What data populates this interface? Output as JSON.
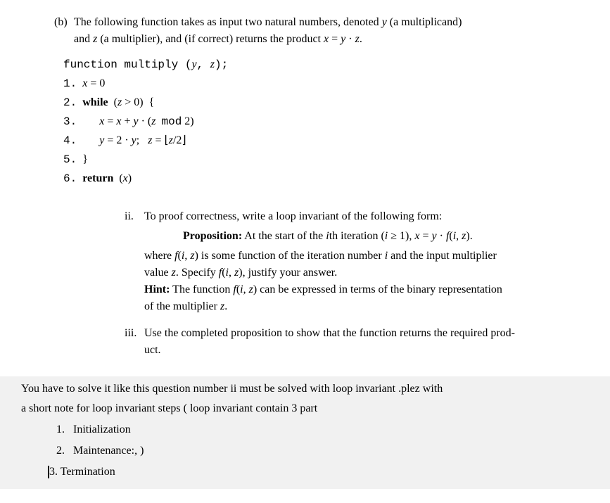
{
  "partLabel": "(b)",
  "intro": {
    "line1": "The following function takes as input two natural numbers, denoted y (a multiplicand)",
    "line2": "and z (a multiplier), and (if correct) returns the product x = y · z."
  },
  "code": {
    "header": "function multiply (y, z);",
    "line1_num": "1.",
    "line1_text": "x = 0",
    "line2_num": "2.",
    "line2_while": "while",
    "line2_cond": "(z > 0)  {",
    "line3_num": "3.",
    "line3_text": "x = x + y · (z  mod 2)",
    "line4_num": "4.",
    "line4_text": "y = 2 · y;   z = ⌊z/2⌋",
    "line5_num": "5.",
    "line5_text": "}",
    "line6_num": "6.",
    "line6_return": "return",
    "line6_arg": "(x)"
  },
  "subItems": {
    "ii": {
      "label": "ii.",
      "line1": "To proof correctness, write a loop invariant of the following form:",
      "propLabel": "Proposition:",
      "propText": " At the start of the ith iteration (i ≥ 1), x = y · f(i, z).",
      "line3": "where f(i, z) is some function of the iteration number i and the input multiplier",
      "line4": "value z. Specify f(i, z), justify your answer.",
      "hintLabel": "Hint:",
      "hintText": " The function f(i, z) can be expressed in terms of the binary representation",
      "line6": "of the multiplier z."
    },
    "iii": {
      "label": "iii.",
      "line1": "Use the completed proposition to show that the function returns the required prod-",
      "line2": "uct."
    }
  },
  "userNote": {
    "line1": "You have to solve it like this question number ii must be solved with loop invariant .plez with",
    "line2": "a short note for loop invariant  steps ( loop invariant contain 3 part",
    "step1_num": "1.",
    "step1_text": "Initialization",
    "step2_num": "2.",
    "step2_text": "Maintenance:, )",
    "step3_num": "3.",
    "step3_text": "Termination"
  }
}
